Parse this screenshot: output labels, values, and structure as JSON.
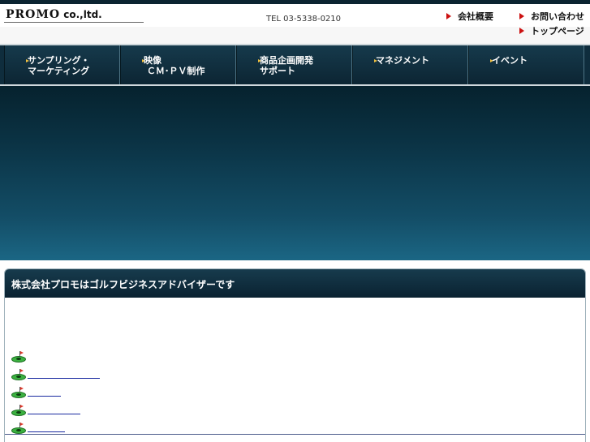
{
  "header": {
    "logo_main": "PROMO",
    "logo_suffix": " co.,ltd.",
    "tel": "TEL 03-5338-0210",
    "links": [
      "会社概要",
      "お問い合わせ",
      "トップページ"
    ]
  },
  "nav": {
    "items": [
      "サンプリング・\nマーケティング",
      "映像\n ＣＭ･ＰＶ制作",
      "商品企画開発\nサポート",
      "マネジメント",
      "イベント"
    ]
  },
  "panel": {
    "title": "株式会社プロモはゴルフビジネスアドバイザーです"
  },
  "colors": {
    "nav_bg": "#0f2d3d",
    "accent_arrow": "#cc1111",
    "link": "#1a2aa0",
    "golf_green": "#3bb140"
  },
  "icons": {
    "header_link": "red-triangle-icon",
    "nav_item": "yellow-arrow-icon",
    "list_item": "golf-green-icon"
  }
}
